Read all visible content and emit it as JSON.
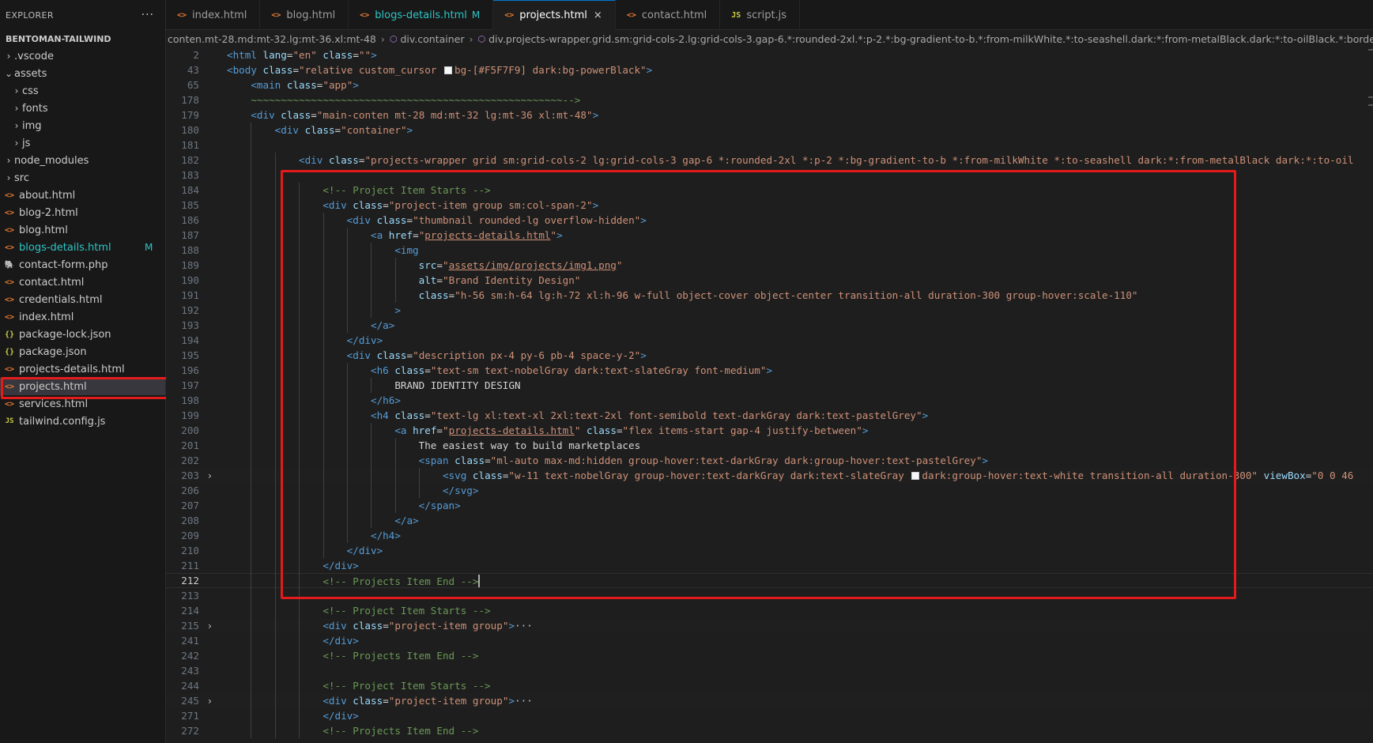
{
  "sidebar": {
    "title": "EXPLORER",
    "more_icon": "more-icon",
    "project_name": "BENTOMAN-TAILWIND",
    "items": [
      {
        "name": ".vscode",
        "type": "folder",
        "depth": 0
      },
      {
        "name": "assets",
        "type": "folder",
        "depth": 0,
        "open": true
      },
      {
        "name": "css",
        "type": "folder",
        "depth": 1
      },
      {
        "name": "fonts",
        "type": "folder",
        "depth": 1
      },
      {
        "name": "img",
        "type": "folder",
        "depth": 1
      },
      {
        "name": "js",
        "type": "folder",
        "depth": 1
      },
      {
        "name": "node_modules",
        "type": "folder",
        "depth": 0
      },
      {
        "name": "src",
        "type": "folder",
        "depth": 0
      },
      {
        "name": "about.html",
        "type": "html",
        "depth": 0
      },
      {
        "name": "blog-2.html",
        "type": "html",
        "depth": 0
      },
      {
        "name": "blog.html",
        "type": "html",
        "depth": 0
      },
      {
        "name": "blogs-details.html",
        "type": "html",
        "depth": 0,
        "badge": "M"
      },
      {
        "name": "contact-form.php",
        "type": "php",
        "depth": 0
      },
      {
        "name": "contact.html",
        "type": "html",
        "depth": 0
      },
      {
        "name": "credentials.html",
        "type": "html",
        "depth": 0
      },
      {
        "name": "index.html",
        "type": "html",
        "depth": 0
      },
      {
        "name": "package-lock.json",
        "type": "json",
        "depth": 0
      },
      {
        "name": "package.json",
        "type": "json",
        "depth": 0
      },
      {
        "name": "projects-details.html",
        "type": "html",
        "depth": 0
      },
      {
        "name": "projects.html",
        "type": "html",
        "depth": 0,
        "active": true
      },
      {
        "name": "services.html",
        "type": "html",
        "depth": 0
      },
      {
        "name": "tailwind.config.js",
        "type": "js",
        "depth": 0
      }
    ]
  },
  "tabs": [
    {
      "label": "index.html",
      "type": "html"
    },
    {
      "label": "blog.html",
      "type": "html"
    },
    {
      "label": "blogs-details.html",
      "type": "html",
      "badge": "M"
    },
    {
      "label": "projects.html",
      "type": "html",
      "active": true,
      "close": "×"
    },
    {
      "label": "contact.html",
      "type": "html"
    },
    {
      "label": "script.js",
      "type": "js"
    }
  ],
  "breadcrumb": [
    "conten.mt-28.md:mt-32.lg:mt-36.xl:mt-48",
    "div.container",
    "div.projects-wrapper.grid.sm:grid-cols-2.lg:grid-cols-3.gap-6.*:rounded-2xl.*:p-2.*:bg-gradient-to-b.*:from-milkWhite.*:to-seashell.dark:*:from-metalBlack.dark:*:to-oilBlack.*:border.*:border-flasWhite.da"
  ],
  "editor": {
    "lines": [
      {
        "n": "2",
        "indent": 0,
        "tokens": [
          [
            "tag",
            "<html"
          ],
          [
            "text",
            " "
          ],
          [
            "attr",
            "lang"
          ],
          [
            "text",
            "="
          ],
          [
            "str",
            "\"en\""
          ],
          [
            "text",
            " "
          ],
          [
            "attr",
            "class"
          ],
          [
            "text",
            "="
          ],
          [
            "str",
            "\"\""
          ],
          [
            "tag",
            ">"
          ]
        ]
      },
      {
        "n": "43",
        "indent": 0,
        "tokens": [
          [
            "tag",
            "<body"
          ],
          [
            "text",
            " "
          ],
          [
            "attr",
            "class"
          ],
          [
            "text",
            "="
          ],
          [
            "str",
            "\"relative custom_cursor "
          ],
          [
            "swatch",
            ""
          ],
          [
            "str",
            "bg-[#F5F7F9] dark:bg-powerBlack\""
          ],
          [
            "tag",
            ">"
          ]
        ]
      },
      {
        "n": "65",
        "indent": 1,
        "tokens": [
          [
            "tag",
            "<main"
          ],
          [
            "text",
            " "
          ],
          [
            "attr",
            "class"
          ],
          [
            "text",
            "="
          ],
          [
            "str",
            "\"app\""
          ],
          [
            "tag",
            ">"
          ]
        ]
      },
      {
        "n": "178",
        "indent": 1,
        "tokens": [
          [
            "comment",
            "~~~~~~~~~~~~~~~~~~~~~~~~~~~~~~~~~~~~~~~~~~~~~~~~~~~~-->"
          ]
        ]
      },
      {
        "n": "179",
        "indent": 1,
        "tokens": [
          [
            "tag",
            "<div"
          ],
          [
            "text",
            " "
          ],
          [
            "attr",
            "class"
          ],
          [
            "text",
            "="
          ],
          [
            "str",
            "\"main-conten mt-28 md:mt-32 lg:mt-36 xl:mt-48\""
          ],
          [
            "tag",
            ">"
          ]
        ]
      },
      {
        "n": "180",
        "indent": 2,
        "tokens": [
          [
            "tag",
            "<div"
          ],
          [
            "text",
            " "
          ],
          [
            "attr",
            "class"
          ],
          [
            "text",
            "="
          ],
          [
            "str",
            "\"container\""
          ],
          [
            "tag",
            ">"
          ]
        ]
      },
      {
        "n": "181",
        "indent": 2,
        "tokens": []
      },
      {
        "n": "182",
        "indent": 3,
        "tokens": [
          [
            "tag",
            "<div"
          ],
          [
            "text",
            " "
          ],
          [
            "attr",
            "class"
          ],
          [
            "text",
            "="
          ],
          [
            "str",
            "\"projects-wrapper grid sm:grid-cols-2 lg:grid-cols-3 gap-6 *:rounded-2xl *:p-2 *:bg-gradient-to-b *:from-milkWhite *:to-seashell dark:*:from-metalBlack dark:*:to-oil"
          ]
        ]
      },
      {
        "n": "183",
        "indent": 3,
        "tokens": []
      },
      {
        "n": "184",
        "indent": 4,
        "tokens": [
          [
            "comment",
            "<!-- Project Item Starts -->"
          ]
        ]
      },
      {
        "n": "185",
        "indent": 4,
        "tokens": [
          [
            "tag",
            "<div"
          ],
          [
            "text",
            " "
          ],
          [
            "attr",
            "class"
          ],
          [
            "text",
            "="
          ],
          [
            "str",
            "\"project-item group sm:col-span-2\""
          ],
          [
            "tag",
            ">"
          ]
        ]
      },
      {
        "n": "186",
        "indent": 5,
        "tokens": [
          [
            "tag",
            "<div"
          ],
          [
            "text",
            " "
          ],
          [
            "attr",
            "class"
          ],
          [
            "text",
            "="
          ],
          [
            "str",
            "\"thumbnail rounded-lg overflow-hidden\""
          ],
          [
            "tag",
            ">"
          ]
        ]
      },
      {
        "n": "187",
        "indent": 6,
        "tokens": [
          [
            "tag",
            "<a"
          ],
          [
            "text",
            " "
          ],
          [
            "attr",
            "href"
          ],
          [
            "text",
            "="
          ],
          [
            "str",
            "\""
          ],
          [
            "stru",
            "projects-details.html"
          ],
          [
            "str",
            "\""
          ],
          [
            "tag",
            ">"
          ]
        ]
      },
      {
        "n": "188",
        "indent": 7,
        "tokens": [
          [
            "tag",
            "<img"
          ]
        ]
      },
      {
        "n": "189",
        "indent": 8,
        "tokens": [
          [
            "attr",
            "src"
          ],
          [
            "text",
            "="
          ],
          [
            "str",
            "\""
          ],
          [
            "stru",
            "assets/img/projects/img1.png"
          ],
          [
            "str",
            "\""
          ]
        ]
      },
      {
        "n": "190",
        "indent": 8,
        "tokens": [
          [
            "attr",
            "alt"
          ],
          [
            "text",
            "="
          ],
          [
            "str",
            "\"Brand Identity Design\""
          ]
        ]
      },
      {
        "n": "191",
        "indent": 8,
        "tokens": [
          [
            "attr",
            "class"
          ],
          [
            "text",
            "="
          ],
          [
            "str",
            "\"h-56 sm:h-64 lg:h-72 xl:h-96 w-full object-cover object-center transition-all duration-300 group-hover:scale-110\""
          ]
        ]
      },
      {
        "n": "192",
        "indent": 7,
        "tokens": [
          [
            "tag",
            ">"
          ]
        ]
      },
      {
        "n": "193",
        "indent": 6,
        "tokens": [
          [
            "tag",
            "</a>"
          ]
        ]
      },
      {
        "n": "194",
        "indent": 5,
        "tokens": [
          [
            "tag",
            "</div>"
          ]
        ]
      },
      {
        "n": "195",
        "indent": 5,
        "tokens": [
          [
            "tag",
            "<div"
          ],
          [
            "text",
            " "
          ],
          [
            "attr",
            "class"
          ],
          [
            "text",
            "="
          ],
          [
            "str",
            "\"description px-4 py-6 pb-4 space-y-2\""
          ],
          [
            "tag",
            ">"
          ]
        ]
      },
      {
        "n": "196",
        "indent": 6,
        "tokens": [
          [
            "tag",
            "<h6"
          ],
          [
            "text",
            " "
          ],
          [
            "attr",
            "class"
          ],
          [
            "text",
            "="
          ],
          [
            "str",
            "\"text-sm text-nobelGray dark:text-slateGray font-medium\""
          ],
          [
            "tag",
            ">"
          ]
        ]
      },
      {
        "n": "197",
        "indent": 7,
        "tokens": [
          [
            "text",
            "BRAND IDENTITY DESIGN"
          ]
        ]
      },
      {
        "n": "198",
        "indent": 6,
        "tokens": [
          [
            "tag",
            "</h6>"
          ]
        ]
      },
      {
        "n": "199",
        "indent": 6,
        "tokens": [
          [
            "tag",
            "<h4"
          ],
          [
            "text",
            " "
          ],
          [
            "attr",
            "class"
          ],
          [
            "text",
            "="
          ],
          [
            "str",
            "\"text-lg xl:text-xl 2xl:text-2xl font-semibold text-darkGray dark:text-pastelGrey\""
          ],
          [
            "tag",
            ">"
          ]
        ]
      },
      {
        "n": "200",
        "indent": 7,
        "tokens": [
          [
            "tag",
            "<a"
          ],
          [
            "text",
            " "
          ],
          [
            "attr",
            "href"
          ],
          [
            "text",
            "="
          ],
          [
            "str",
            "\""
          ],
          [
            "stru",
            "projects-details.html"
          ],
          [
            "str",
            "\""
          ],
          [
            "text",
            " "
          ],
          [
            "attr",
            "class"
          ],
          [
            "text",
            "="
          ],
          [
            "str",
            "\"flex items-start gap-4 justify-between\""
          ],
          [
            "tag",
            ">"
          ]
        ]
      },
      {
        "n": "201",
        "indent": 8,
        "tokens": [
          [
            "text",
            "The easiest way to build marketplaces"
          ]
        ]
      },
      {
        "n": "202",
        "indent": 8,
        "tokens": [
          [
            "tag",
            "<span"
          ],
          [
            "text",
            " "
          ],
          [
            "attr",
            "class"
          ],
          [
            "text",
            "="
          ],
          [
            "str",
            "\"ml-auto max-md:hidden group-hover:text-darkGray dark:group-hover:text-pastelGrey\""
          ],
          [
            "tag",
            ">"
          ]
        ]
      },
      {
        "n": "203",
        "indent": 9,
        "fold": "›",
        "tokens": [
          [
            "tag",
            "<svg"
          ],
          [
            "text",
            " "
          ],
          [
            "attr",
            "class"
          ],
          [
            "text",
            "="
          ],
          [
            "str",
            "\"w-11 text-nobelGray group-hover:text-darkGray dark:text-slateGray "
          ],
          [
            "swatch",
            ""
          ],
          [
            "str",
            "dark:group-hover:text-white transition-all duration-300\""
          ],
          [
            "text",
            " "
          ],
          [
            "attr",
            "viewBox"
          ],
          [
            "text",
            "="
          ],
          [
            "str",
            "\"0 0 46"
          ]
        ]
      },
      {
        "n": "206",
        "indent": 9,
        "tokens": [
          [
            "tag",
            "</svg>"
          ]
        ]
      },
      {
        "n": "207",
        "indent": 8,
        "tokens": [
          [
            "tag",
            "</span>"
          ]
        ]
      },
      {
        "n": "208",
        "indent": 7,
        "tokens": [
          [
            "tag",
            "</a>"
          ]
        ]
      },
      {
        "n": "209",
        "indent": 6,
        "tokens": [
          [
            "tag",
            "</h4>"
          ]
        ]
      },
      {
        "n": "210",
        "indent": 5,
        "tokens": [
          [
            "tag",
            "</div>"
          ]
        ]
      },
      {
        "n": "211",
        "indent": 4,
        "tokens": [
          [
            "tag",
            "</div>"
          ]
        ]
      },
      {
        "n": "212",
        "indent": 4,
        "current": true,
        "tokens": [
          [
            "comment",
            "<!-- Projects Item End -->"
          ],
          [
            "cursor",
            ""
          ]
        ]
      },
      {
        "n": "213",
        "indent": 4,
        "tokens": []
      },
      {
        "n": "214",
        "indent": 4,
        "tokens": [
          [
            "comment",
            "<!-- Project Item Starts -->"
          ]
        ]
      },
      {
        "n": "215",
        "indent": 4,
        "fold": "›",
        "tokens": [
          [
            "tag",
            "<div"
          ],
          [
            "text",
            " "
          ],
          [
            "attr",
            "class"
          ],
          [
            "text",
            "="
          ],
          [
            "str",
            "\"project-item group\""
          ],
          [
            "tag",
            ">"
          ],
          [
            "ell",
            "···"
          ]
        ]
      },
      {
        "n": "241",
        "indent": 4,
        "tokens": [
          [
            "tag",
            "</div>"
          ]
        ]
      },
      {
        "n": "242",
        "indent": 4,
        "tokens": [
          [
            "comment",
            "<!-- Projects Item End -->"
          ]
        ]
      },
      {
        "n": "243",
        "indent": 4,
        "tokens": []
      },
      {
        "n": "244",
        "indent": 4,
        "tokens": [
          [
            "comment",
            "<!-- Project Item Starts -->"
          ]
        ]
      },
      {
        "n": "245",
        "indent": 4,
        "fold": "›",
        "tokens": [
          [
            "tag",
            "<div"
          ],
          [
            "text",
            " "
          ],
          [
            "attr",
            "class"
          ],
          [
            "text",
            "="
          ],
          [
            "str",
            "\"project-item group\""
          ],
          [
            "tag",
            ">"
          ],
          [
            "ell",
            "···"
          ]
        ]
      },
      {
        "n": "271",
        "indent": 4,
        "tokens": [
          [
            "tag",
            "</div>"
          ]
        ]
      },
      {
        "n": "272",
        "indent": 4,
        "tokens": [
          [
            "comment",
            "<!-- Projects Item End -->"
          ]
        ]
      }
    ]
  },
  "colors": {
    "highlight": "#e31b1b",
    "modified": "#2ec4c4",
    "html_icon": "#e37933",
    "json_icon": "#cbcb41"
  }
}
